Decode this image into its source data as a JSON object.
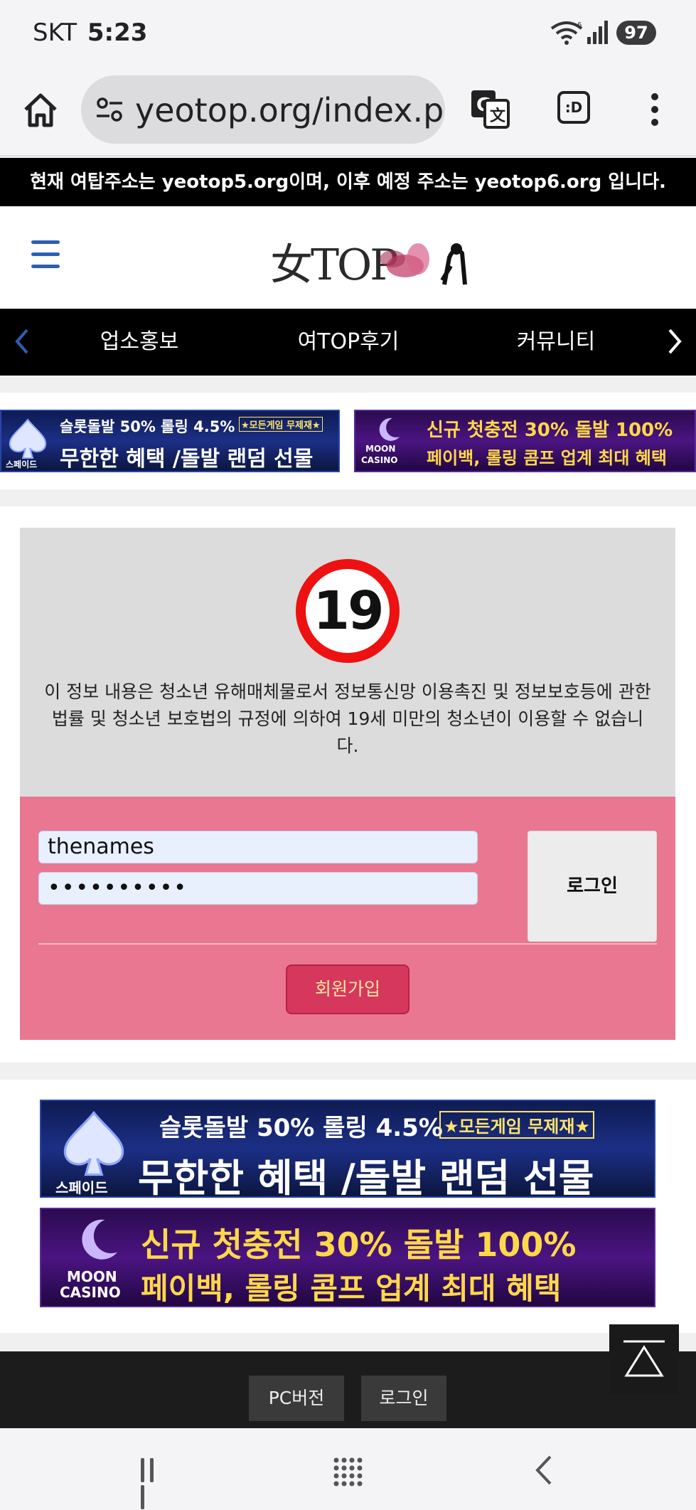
{
  "status_bar": {
    "carrier": "SKT",
    "time": "5:23",
    "wifi_badge": "6",
    "battery": "97"
  },
  "browser": {
    "url": "yeotop.org/index.pl",
    "tabs_label": ":D",
    "icons": [
      "home-icon",
      "site-settings-icon",
      "translate-icon",
      "tabs-icon",
      "more-vert-icon"
    ]
  },
  "notice": "현재 여탑주소는 yeotop5.org이며, 이후 예정 주소는 yeotop6.org 입니다.",
  "header": {
    "logo_text": "女TOP"
  },
  "nav": {
    "items": [
      "업소홍보",
      "여TOP후기",
      "커뮤니티"
    ]
  },
  "ads": {
    "spade": {
      "line1": "슬롯돌발 50% 롤링 4.5%",
      "tag": "★모든게임 무제재★",
      "line2": "무한한 혜택 /돌발 랜덤 선물",
      "brand": "스페이드"
    },
    "moon": {
      "line1": "신규 첫충전 30% 돌발 100%",
      "line2": "페이백, 롤링 콤프 업계 최대 혜택",
      "brand_top": "MOON",
      "brand_bottom": "CASINO"
    }
  },
  "age_gate": {
    "badge": "19",
    "message": "이 정보 내용은 청소년 유해매체물로서 정보통신망 이용촉진 및 정보보호등에 관한 법률 및 청소년 보호법의 규정에 의하여 19세 미만의 청소년이 이용할 수 없습니다."
  },
  "login": {
    "username_value": "thenames",
    "password_value": "••••••••••",
    "login_button": "로그인",
    "signup_button": "회원가입"
  },
  "footer": {
    "pc_version": "PC버전",
    "login": "로그인"
  },
  "colors": {
    "login_panel": "#e97792",
    "signup_button": "#d6385d",
    "age_badge_ring": "#ee1111",
    "nav_background": "#000000",
    "link_blue": "#2d5fb3"
  }
}
